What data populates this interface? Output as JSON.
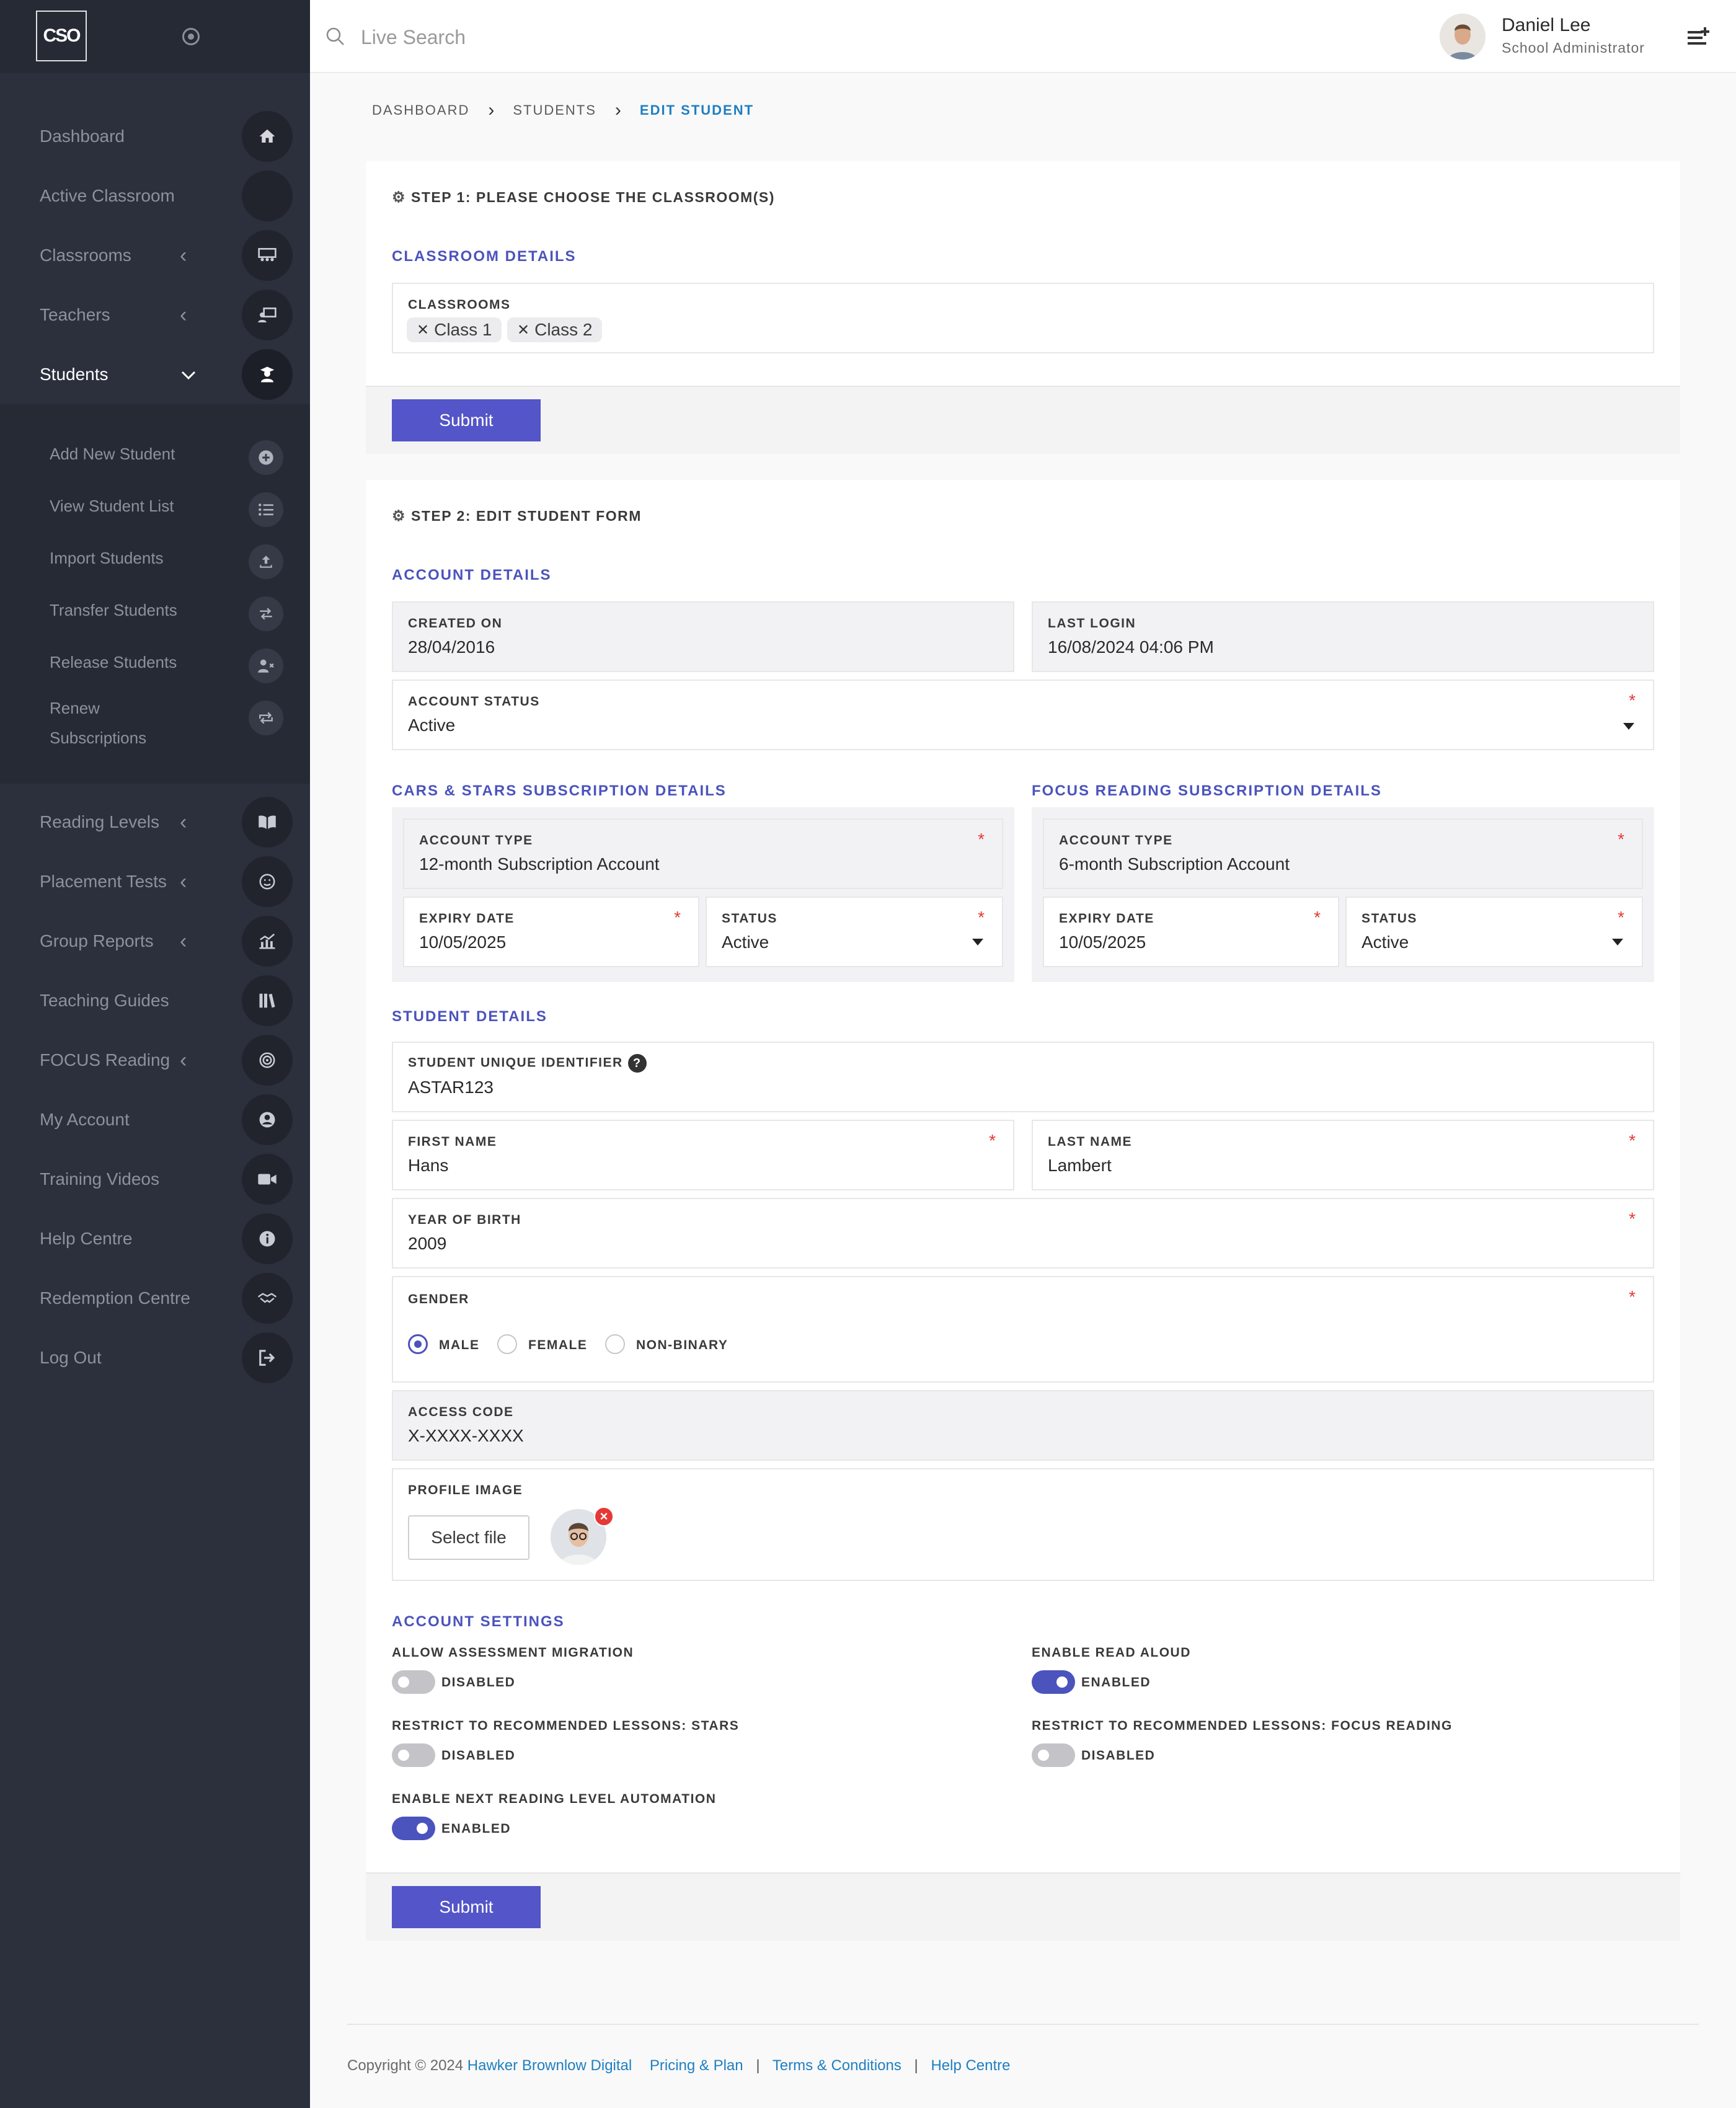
{
  "sidebar": {
    "logo": "CSO",
    "items": [
      {
        "label": "Dashboard",
        "icon": "home-icon",
        "caret": ""
      },
      {
        "label": "Active Classroom",
        "icon": "classroom-icon",
        "caret": ""
      },
      {
        "label": "Classrooms",
        "icon": "classrooms-icon",
        "caret": "‹"
      },
      {
        "label": "Teachers",
        "icon": "teacher-icon",
        "caret": "‹"
      },
      {
        "label": "Students",
        "icon": "student-icon",
        "caret": "⌄"
      },
      {
        "label": "Reading Levels",
        "icon": "book-icon",
        "caret": "‹"
      },
      {
        "label": "Placement Tests",
        "icon": "test-icon",
        "caret": "‹"
      },
      {
        "label": "Group Reports",
        "icon": "chart-icon",
        "caret": "‹"
      },
      {
        "label": "Teaching Guides",
        "icon": "guides-icon",
        "caret": ""
      },
      {
        "label": "FOCUS Reading",
        "icon": "target-icon",
        "caret": "‹"
      },
      {
        "label": "My Account",
        "icon": "account-icon",
        "caret": ""
      },
      {
        "label": "Training Videos",
        "icon": "video-icon",
        "caret": ""
      },
      {
        "label": "Help Centre",
        "icon": "info-icon",
        "caret": ""
      },
      {
        "label": "Redemption Centre",
        "icon": "handshake-icon",
        "caret": ""
      },
      {
        "label": "Log Out",
        "icon": "logout-icon",
        "caret": ""
      }
    ],
    "sub_items": [
      {
        "label": "Add New Student",
        "icon": "plus-circle-icon"
      },
      {
        "label": "View Student List",
        "icon": "list-icon"
      },
      {
        "label": "Import Students",
        "icon": "upload-icon"
      },
      {
        "label": "Transfer Students",
        "icon": "transfer-icon"
      },
      {
        "label": "Release Students",
        "icon": "user-remove-icon"
      },
      {
        "label": "Renew Subscriptions",
        "icon": "renew-icon"
      }
    ]
  },
  "topbar": {
    "search_placeholder": "Live Search",
    "user_name": "Daniel Lee",
    "user_role": "School Administrator"
  },
  "breadcrumb": {
    "items": [
      "DASHBOARD",
      "STUDENTS"
    ],
    "current": "EDIT STUDENT"
  },
  "step1": {
    "title": "STEP 1: PLEASE CHOOSE THE CLASSROOM(S)",
    "section": "CLASSROOM DETAILS",
    "classrooms_label": "CLASSROOMS",
    "chips": [
      "Class 1",
      "Class 2"
    ],
    "submit_label": "Submit"
  },
  "step2": {
    "title": "STEP 2: EDIT STUDENT FORM",
    "account_section": "ACCOUNT DETAILS",
    "created_on_label": "CREATED ON",
    "created_on": "28/04/2016",
    "last_login_label": "LAST LOGIN",
    "last_login": "16/08/2024 04:06 PM",
    "account_status_label": "ACCOUNT STATUS",
    "account_status": "Active",
    "cars_section": "CARS & STARS SUBSCRIPTION DETAILS",
    "focus_section": "FOCUS READING SUBSCRIPTION DETAILS",
    "account_type_label": "ACCOUNT TYPE",
    "expiry_label": "EXPIRY DATE",
    "status_label": "STATUS",
    "cars": {
      "account_type": "12-month Subscription Account",
      "expiry": "10/05/2025",
      "status": "Active"
    },
    "focus": {
      "account_type": "6-month Subscription Account",
      "expiry": "10/05/2025",
      "status": "Active"
    },
    "student_section": "STUDENT DETAILS",
    "uid_label": "STUDENT UNIQUE IDENTIFIER",
    "uid": "ASTAR123",
    "first_name_label": "FIRST NAME",
    "first_name": "Hans",
    "last_name_label": "LAST NAME",
    "last_name": "Lambert",
    "yob_label": "YEAR OF BIRTH",
    "yob": "2009",
    "gender_label": "GENDER",
    "gender_options": [
      "MALE",
      "FEMALE",
      "NON-BINARY"
    ],
    "gender_selected": "MALE",
    "access_code_label": "ACCESS CODE",
    "access_code": "X-XXXX-XXXX",
    "profile_image_label": "PROFILE IMAGE",
    "select_file_label": "Select file",
    "settings_section": "ACCOUNT SETTINGS",
    "settings": [
      {
        "label": "ALLOW ASSESSMENT MIGRATION",
        "state": "DISABLED",
        "on": false
      },
      {
        "label": "ENABLE READ ALOUD",
        "state": "ENABLED",
        "on": true
      },
      {
        "label": "RESTRICT TO RECOMMENDED LESSONS: STARS",
        "state": "DISABLED",
        "on": false
      },
      {
        "label": "RESTRICT TO RECOMMENDED LESSONS: FOCUS READING",
        "state": "DISABLED",
        "on": false
      },
      {
        "label": "ENABLE NEXT READING LEVEL AUTOMATION",
        "state": "ENABLED",
        "on": true
      }
    ],
    "submit_label": "Submit"
  },
  "footer": {
    "copyright": "Copyright © 2024",
    "company": "Hawker Brownlow Digital",
    "links": [
      "Pricing & Plan",
      "Terms & Conditions",
      "Help Centre"
    ]
  },
  "colors": {
    "sidebar": "#2c303d",
    "accent": "#4b53bd",
    "button": "#5455c8",
    "link": "#1f7fc2",
    "required": "#e53935"
  }
}
